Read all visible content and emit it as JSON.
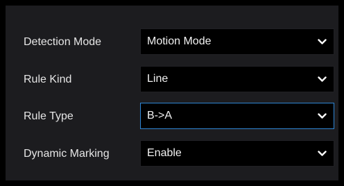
{
  "form": {
    "rows": [
      {
        "label": "Detection Mode",
        "value": "Motion Mode"
      },
      {
        "label": "Rule Kind",
        "value": "Line"
      },
      {
        "label": "Rule Type",
        "value": "B->A"
      },
      {
        "label": "Dynamic Marking",
        "value": "Enable"
      }
    ]
  },
  "colors": {
    "background": "#000000",
    "panel": "#1c1c1f",
    "label_text": "#e6e6e6",
    "field_background": "#000000",
    "focus_border": "#2f87d6"
  },
  "icons": {
    "dropdown": "chevron-down-icon"
  }
}
